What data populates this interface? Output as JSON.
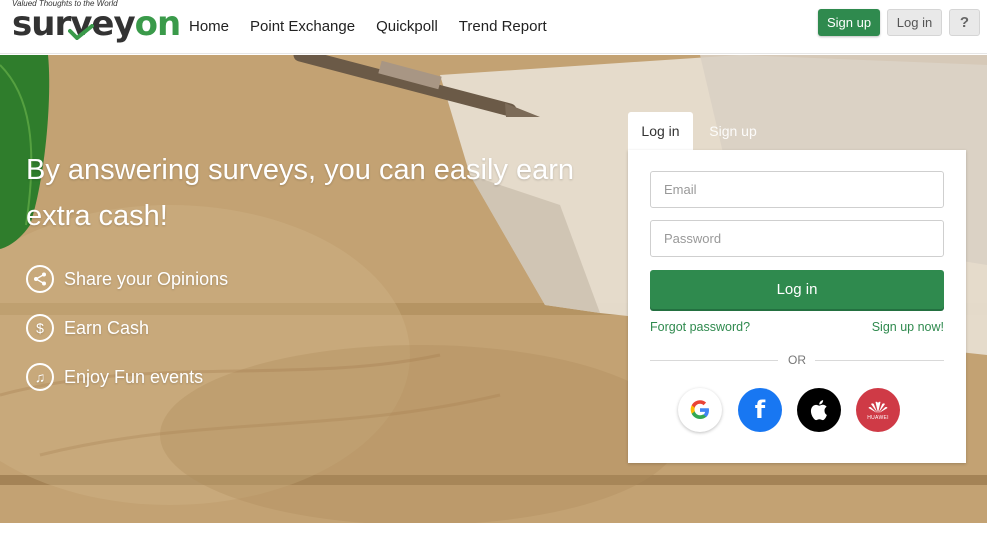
{
  "brand": {
    "tagline": "Valued Thoughts to the World",
    "name_part1": "sur",
    "name_part2": "vey",
    "name_part3": "on"
  },
  "nav": {
    "items": [
      {
        "label": "Home"
      },
      {
        "label": "Point Exchange"
      },
      {
        "label": "Quickpoll"
      },
      {
        "label": "Trend Report"
      }
    ]
  },
  "header_actions": {
    "signup_label": "Sign up",
    "login_label": "Log in",
    "help_label": "?"
  },
  "hero": {
    "headline": "By answering surveys, you can easily earn extra cash!",
    "features": [
      {
        "label": "Share your Opinions",
        "icon": "share-icon"
      },
      {
        "label": "Earn Cash",
        "icon": "dollar-icon"
      },
      {
        "label": "Enjoy Fun events",
        "icon": "music-note-icon"
      }
    ]
  },
  "auth": {
    "tabs": [
      {
        "label": "Log in",
        "active": true
      },
      {
        "label": "Sign up",
        "active": false
      }
    ],
    "email_placeholder": "Email",
    "password_placeholder": "Password",
    "submit_label": "Log in",
    "forgot_label": "Forgot password?",
    "signup_link_label": "Sign up now!",
    "divider_label": "OR",
    "social": [
      {
        "name": "google-icon"
      },
      {
        "name": "facebook-icon"
      },
      {
        "name": "apple-icon"
      },
      {
        "name": "huawei-icon",
        "caption": "HUAWEI"
      }
    ]
  },
  "colors": {
    "accent": "#2f8a4e",
    "facebook": "#1877f2",
    "apple": "#000000",
    "huawei": "#cf3a46"
  }
}
